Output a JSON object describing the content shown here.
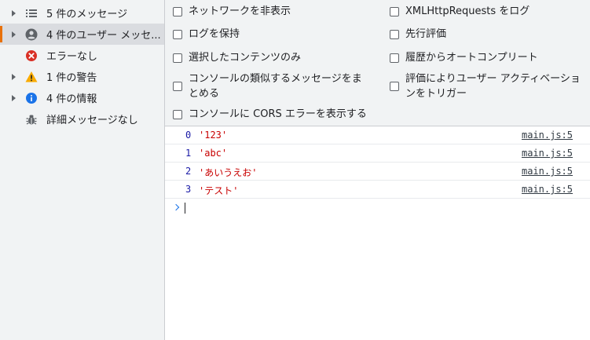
{
  "sidebar": {
    "items": [
      {
        "label": "5 件のメッセージ",
        "icon": "list-icon"
      },
      {
        "label": "4 件のユーザー メッセ...",
        "icon": "user-icon"
      },
      {
        "label": "エラーなし",
        "icon": "error-icon"
      },
      {
        "label": "1 件の警告",
        "icon": "warning-icon"
      },
      {
        "label": "4 件の情報",
        "icon": "info-icon"
      },
      {
        "label": "詳細メッセージなし",
        "icon": "bug-icon"
      }
    ]
  },
  "filters": {
    "left": [
      {
        "label": "ネットワークを非表示"
      },
      {
        "label": "ログを保持"
      },
      {
        "label": "選択したコンテンツのみ"
      },
      {
        "label_line1": "コンソールの類似するメッセージをま",
        "label_line2": "とめる"
      },
      {
        "label": "コンソールに CORS エラーを表示する"
      }
    ],
    "right": [
      {
        "label": "XMLHttpRequests をログ"
      },
      {
        "label": "先行評価"
      },
      {
        "label": "履歴からオートコンプリート"
      },
      {
        "label_line1": "評価によりユーザー アクティベーショ",
        "label_line2": "ンをトリガー"
      }
    ]
  },
  "console": {
    "rows": [
      {
        "index": "0",
        "value": "'123'",
        "source": "main.js:5"
      },
      {
        "index": "1",
        "value": "'abc'",
        "source": "main.js:5"
      },
      {
        "index": "2",
        "value": "'あいうえお'",
        "source": "main.js:5"
      },
      {
        "index": "3",
        "value": "'テスト'",
        "source": "main.js:5"
      }
    ]
  },
  "colors": {
    "accent": "#e8710a",
    "error": "#d93025",
    "warning": "#f9ab00",
    "info": "#1a73e8",
    "string": "#c80000",
    "index": "#1a1aa6"
  }
}
